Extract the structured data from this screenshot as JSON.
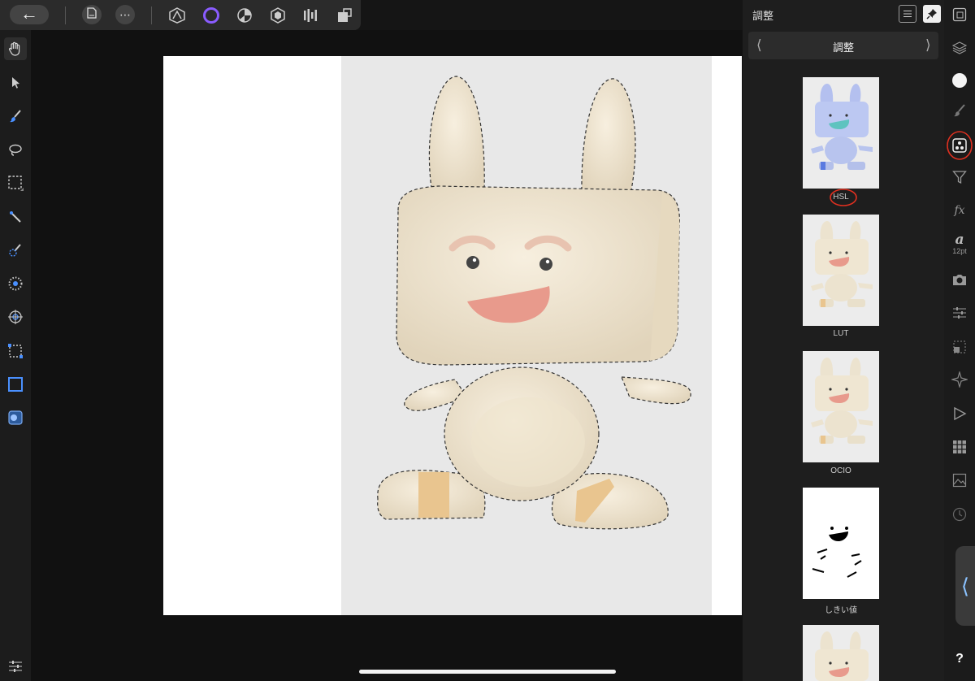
{
  "top_toolbar": {
    "back_icon": "arrow-left-icon",
    "document_icon": "document-icon",
    "more_icon": "more-dots-icon",
    "personas": [
      "photo-persona-icon",
      "liquify-persona-icon",
      "develop-persona-icon",
      "tone-mapping-persona-icon",
      "export-persona-icon",
      "pixel-persona-icon"
    ]
  },
  "left_tools": [
    "hand-tool",
    "move-tool",
    "paint-brush-tool",
    "freehand-selection-tool",
    "rectangular-marquee-tool",
    "flood-select-tool",
    "selection-brush-tool",
    "radial-tool",
    "mesh-warp-tool",
    "crop-tool",
    "selection-rectangle-tool",
    "quick-mask-tool",
    "tool-settings-tool"
  ],
  "adjustment_panel": {
    "title": "調整",
    "category": "調整",
    "items": [
      {
        "label": "HSL"
      },
      {
        "label": "LUT"
      },
      {
        "label": "OCIO"
      },
      {
        "label": "しきい値"
      }
    ]
  },
  "studio": {
    "text_size": "12pt",
    "help": "?",
    "icons": [
      "navigator-icon",
      "layers-icon",
      "color-icon",
      "brushes-icon",
      "adjustments-icon",
      "filters-icon",
      "fx-icon",
      "text-icon",
      "snapshots-icon",
      "sliders-icon",
      "transform-icon",
      "compass-icon",
      "macros-icon",
      "swatches-icon",
      "stock-icon",
      "history-icon"
    ]
  },
  "colors": {
    "accent_blue": "#4a90ff",
    "annotation_red": "#e03020",
    "persona_purple": "#8a5cff"
  }
}
